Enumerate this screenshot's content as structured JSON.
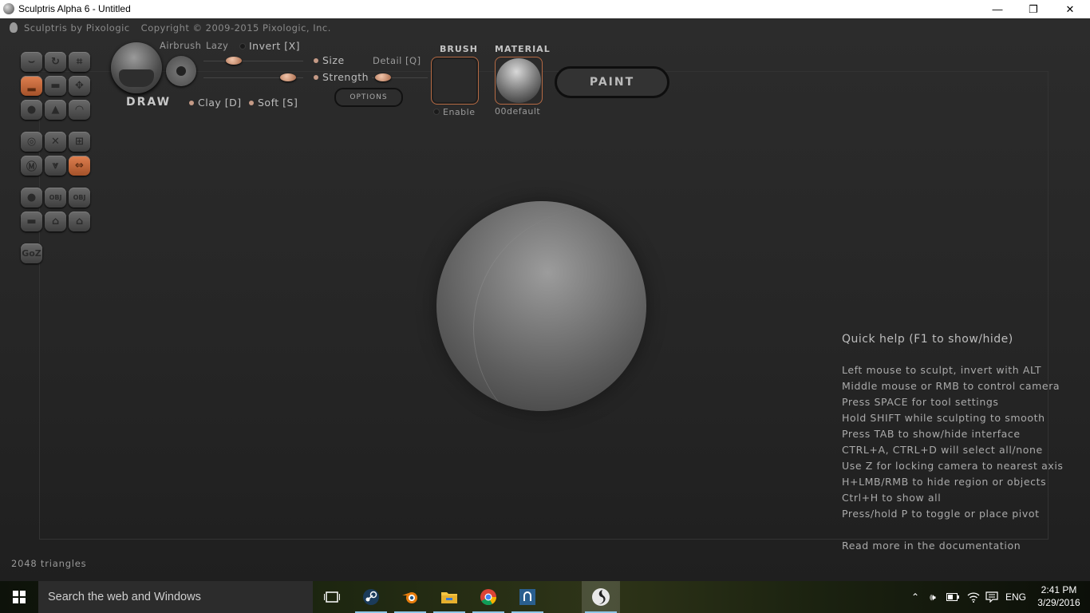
{
  "window": {
    "title": "Sculptris Alpha 6 - Untitled",
    "minimize": "—",
    "restore": "❐",
    "close": "✕"
  },
  "app": {
    "copyright_name": "Sculptris by Pixologic",
    "copyright": "Copyright © 2009-2015 Pixologic, Inc."
  },
  "tools": {
    "goz": "GoZ",
    "obj_import": "OBJ",
    "obj_export": "OBJ"
  },
  "brush_panel": {
    "tool_name": "DRAW",
    "airbrush": "Airbrush",
    "lazy": "Lazy",
    "invert": "Invert [X]",
    "size": "Size",
    "strength": "Strength",
    "detail": "Detail [Q]",
    "clay": "Clay [D]",
    "soft": "Soft [S]",
    "options": "OPTIONS",
    "brush_title": "BRUSH",
    "brush_enable": "Enable",
    "material_title": "MATERIAL",
    "material_name": "00default",
    "paint": "PAINT",
    "lazy_value": 0.3,
    "size_value": 0.85,
    "detail_value": 0.2
  },
  "quick_help": {
    "title": "Quick help (F1 to show/hide)",
    "lines": [
      "Left mouse to sculpt, invert with ALT",
      "Middle mouse or RMB to control camera",
      "Press SPACE for tool settings",
      "Hold SHIFT while sculpting to smooth",
      "Press TAB to show/hide interface",
      "CTRL+A, CTRL+D will select all/none",
      "Use Z for locking camera to nearest axis",
      "H+LMB/RMB to hide region or objects",
      "Ctrl+H to show all",
      "Press/hold P to toggle or place pivot"
    ],
    "more": "Read more in the documentation"
  },
  "status": {
    "triangles": "2048 triangles"
  },
  "taskbar": {
    "search_placeholder": "Search the web and Windows",
    "language": "ENG",
    "time": "2:41 PM",
    "date": "3/29/2016",
    "icons": [
      "task-view-icon",
      "steam-icon",
      "blender-icon",
      "file-explorer-icon",
      "chrome-icon",
      "app-icon",
      "sculptris-icon"
    ]
  },
  "colors": {
    "accent": "#c0693c",
    "panel_bg": "#2a2a2a",
    "text": "#aaaaaa"
  }
}
